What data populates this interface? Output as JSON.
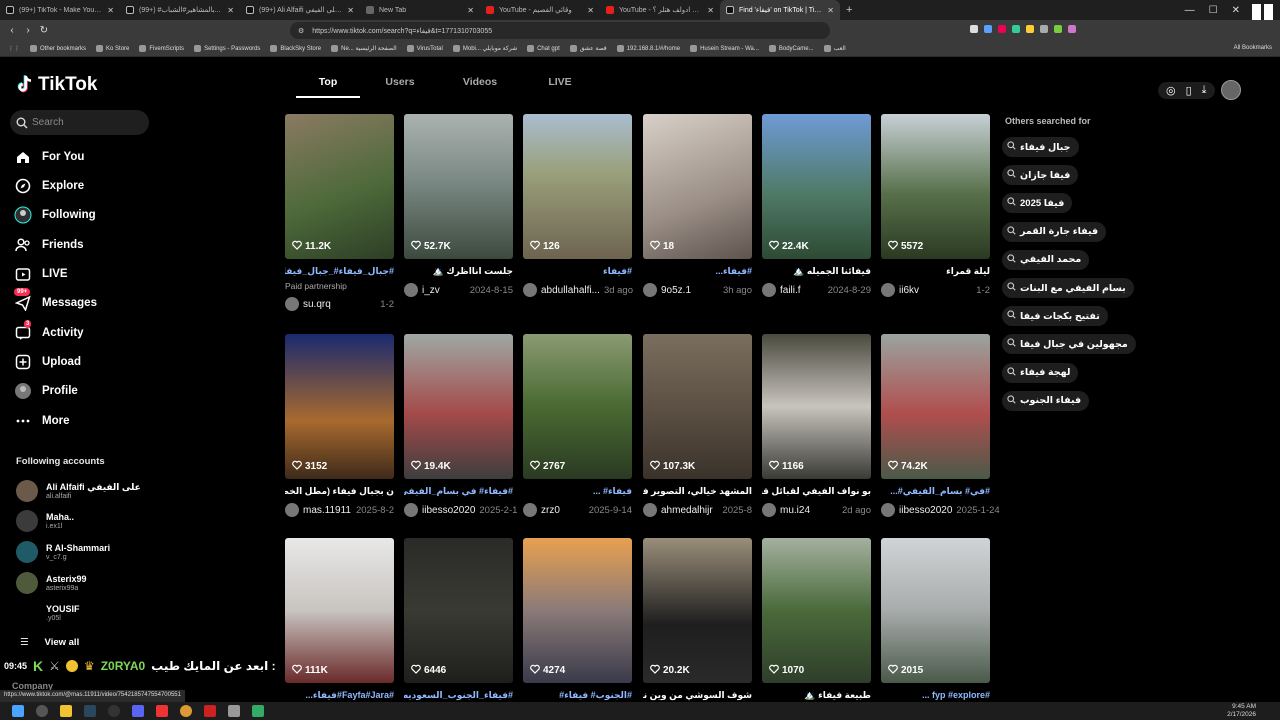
{
  "browser": {
    "tabs": [
      {
        "title": "(99+) TikTok - Make Your Day",
        "fav": "tt"
      },
      {
        "title": "(99+) #بالمشاهير#الشباب...",
        "fav": "tt"
      },
      {
        "title": "(99+) Ali Alfaifi على الفيفي (@alialfaifi)",
        "fav": "tt"
      },
      {
        "title": "New Tab",
        "fav": "gen"
      },
      {
        "title": "YouTube - وقائي الفصيم",
        "fav": "yt"
      },
      {
        "title": "YouTube - ابن اخبرني ادولف هتلر ؟",
        "fav": "yt"
      },
      {
        "title": "Find 'فيفاء' on TikTok | TikTok Se...",
        "fav": "tt",
        "active": true
      }
    ],
    "url": "https://www.tiktok.com/search?q=فيفاء&t=1771310703055",
    "bookmarks": [
      "Other bookmarks",
      "Ko Store",
      "FivemScripts",
      "Settings - Passwords",
      "BlackSky Store",
      "Ne... الصفحة الرئيسية",
      "VirusTotal",
      "Mobi... شركة موبايلي",
      "Chat gpt",
      "قصة عشق",
      "192.168.8.1/#/home",
      "Husein Stream - Wa...",
      "BodyCame...",
      "العب"
    ],
    "all_bookmarks": "All Bookmarks",
    "status_url": "https://www.tiktok.com/@mas.11911/video/7542185747554700551"
  },
  "sidebar": {
    "logo": "TikTok",
    "search_placeholder": "Search",
    "nav": [
      {
        "label": "For You",
        "icon": "home-icon"
      },
      {
        "label": "Explore",
        "icon": "compass-icon"
      },
      {
        "label": "Following",
        "icon": "following-icon"
      },
      {
        "label": "Friends",
        "icon": "friends-icon"
      },
      {
        "label": "LIVE",
        "icon": "live-icon"
      },
      {
        "label": "Messages",
        "icon": "messages-icon",
        "badge": "99+"
      },
      {
        "label": "Activity",
        "icon": "activity-icon",
        "badge": "3"
      },
      {
        "label": "Upload",
        "icon": "upload-icon"
      },
      {
        "label": "Profile",
        "icon": "profile-icon"
      },
      {
        "label": "More",
        "icon": "more-icon"
      }
    ],
    "following_title": "Following accounts",
    "accounts": [
      {
        "name": "Ali Alfaifi على الفيفي",
        "user": "ali.alfaifi"
      },
      {
        "name": "Maha..",
        "user": "i.ex1l"
      },
      {
        "name": "R Al-Shammari",
        "user": "v_c7.g"
      },
      {
        "name": "Asterix99",
        "user": "asterix99a"
      },
      {
        "name": "YOUSIF",
        "user": ".y05l"
      }
    ],
    "view_all": "View all",
    "company": "Company"
  },
  "overlay": {
    "time": "09:45",
    "name": "Z0RYA0",
    "msg": "ابعد عن المايك طيب :"
  },
  "tabs": [
    "Top",
    "Users",
    "Videos",
    "LIVE"
  ],
  "active_tab": "Top",
  "videos": [
    {
      "likes": "11.2K",
      "caption": "#جبال_فيفاء#_جبال_فيفاء ...",
      "tag": true,
      "paid": "Paid partnership",
      "user": "su.qrq",
      "date": "1-2"
    },
    {
      "likes": "52.7K",
      "caption": "جلست انااظرك 🏔️",
      "tag": false,
      "user": "i_zv",
      "date": "2024-8-15"
    },
    {
      "likes": "126",
      "caption": "#فيفاء",
      "tag": true,
      "user": "abdullahalfi...",
      "date": "3d ago"
    },
    {
      "likes": "18",
      "caption": "#فيفاء...",
      "tag": true,
      "user": "9o5z.1",
      "date": "3h ago"
    },
    {
      "likes": "22.4K",
      "caption": "فيفائنا الجميله 🏔️",
      "tag": false,
      "user": "faili.f",
      "date": "2024-8-29"
    },
    {
      "likes": "5572",
      "caption": "ليلة قمراء",
      "tag": false,
      "user": "ii6kv",
      "date": "1-2"
    },
    {
      "likes": "3152",
      "caption": "ن بجبال فيفاء (مطل الخطم) ...",
      "tag": false,
      "user": "mas.11911",
      "date": "2025-8-2"
    },
    {
      "likes": "19.4K",
      "caption": "#فيفاء# في بسام_الفيفي#...",
      "tag": true,
      "user": "iibesso2020",
      "date": "2025-2-1"
    },
    {
      "likes": "2767",
      "caption": "فيفاء# ...",
      "tag": true,
      "user": "zrz0",
      "date": "2025-9-14"
    },
    {
      "likes": "107.3K",
      "caption": "المشهد خيالي، التصوير في ...",
      "tag": false,
      "user": "ahmedalhijr",
      "date": "2025-8"
    },
    {
      "likes": "1166",
      "caption": "بو نواف الفيفي لقبائل قحطان ...",
      "tag": false,
      "user": "mu.i24",
      "date": "2d ago"
    },
    {
      "likes": "74.2K",
      "caption": "#في# بسام_الفيفي#...",
      "tag": true,
      "user": "iibesso2020",
      "date": "2025-1-24"
    },
    {
      "likes": "111K",
      "caption": "#Fayfa#Jara#فيفاء...",
      "tag": true
    },
    {
      "likes": "6446",
      "caption": "#فيفاء_الجنوب_السعوديه...",
      "tag": true
    },
    {
      "likes": "4274",
      "caption": "#الجنوب# فيفاء#",
      "tag": true
    },
    {
      "likes": "20.2K",
      "caption": "شوف السوشي من وين نجيبه ...",
      "tag": false
    },
    {
      "likes": "1070",
      "caption": "طبيعة فيفاء 🏔️",
      "tag": false
    },
    {
      "likes": "2015",
      "caption": "#fyp #explore ...",
      "tag": true
    }
  ],
  "others_title": "Others searched for",
  "others": [
    "جبال فيفاء",
    "فيفا جازان",
    "فيفا 2025",
    "فيفاء جارة القمر",
    "محمد الفيفي",
    "بسام الفيفي مع البنات",
    "تفتيح بكجات فيفا",
    "مجهولين في جبال فيفا",
    "لهجة فيفاء",
    "فيفاء الجنوب"
  ],
  "tray": {
    "time": "9:45 AM",
    "date": "2/17/2026"
  },
  "colors": {
    "accent": "#fe2c55",
    "hashtag": "#8fb9ff",
    "bg": "#000000"
  }
}
